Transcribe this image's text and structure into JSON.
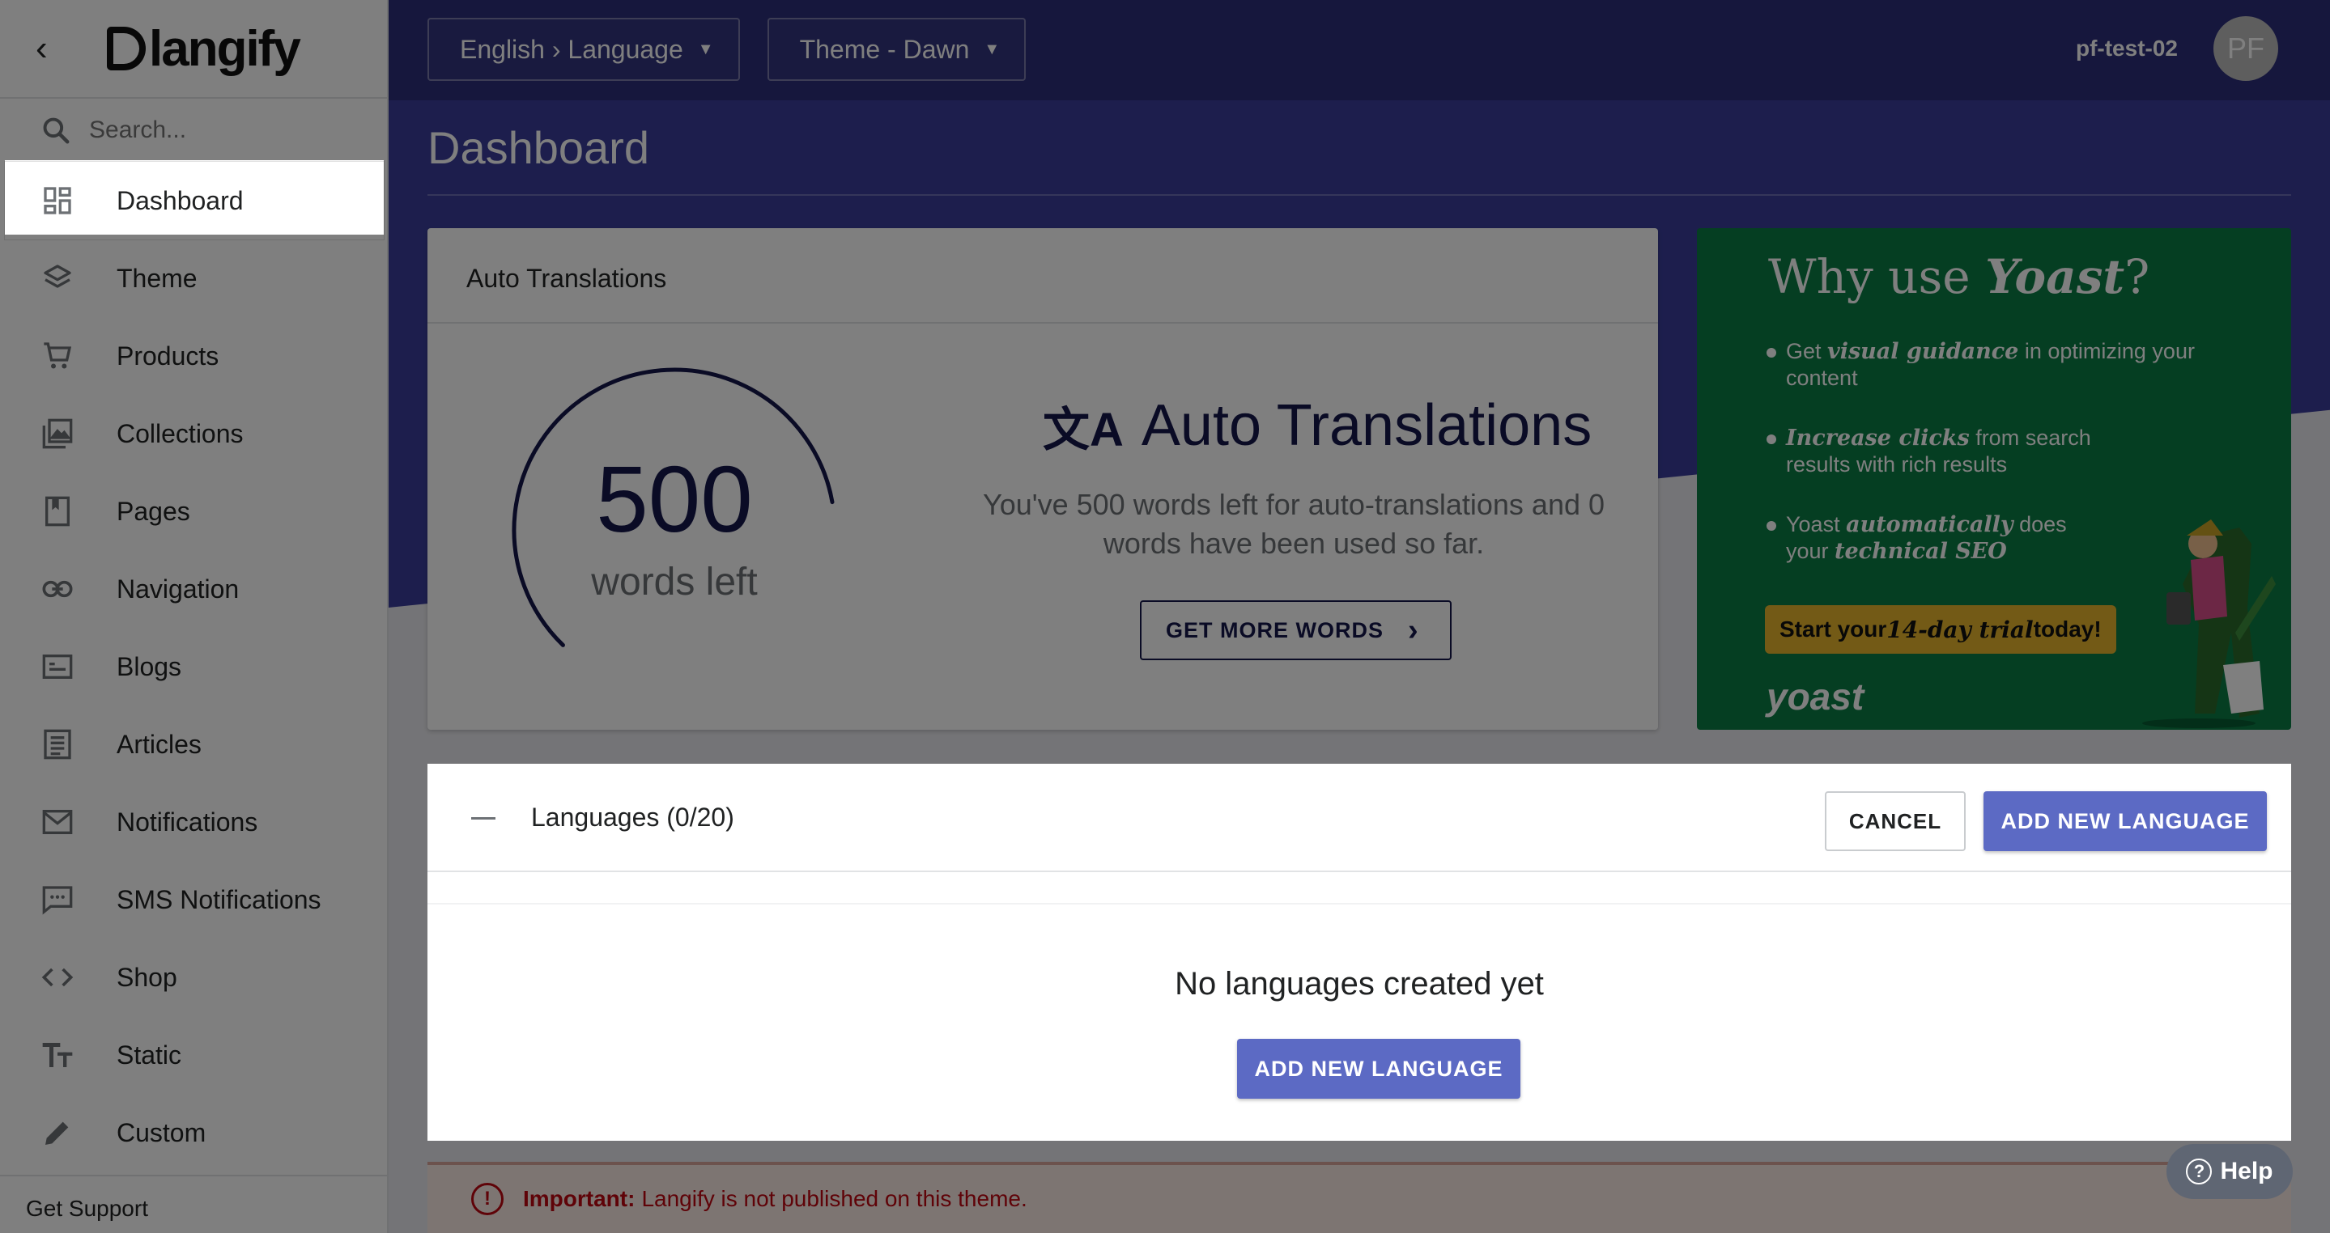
{
  "sidebar": {
    "logo_text": "langify",
    "search_placeholder": "Search...",
    "items": [
      {
        "label": "Dashboard"
      },
      {
        "label": "Theme"
      },
      {
        "label": "Products"
      },
      {
        "label": "Collections"
      },
      {
        "label": "Pages"
      },
      {
        "label": "Navigation"
      },
      {
        "label": "Blogs"
      },
      {
        "label": "Articles"
      },
      {
        "label": "Notifications"
      },
      {
        "label": "SMS Notifications"
      },
      {
        "label": "Shop"
      },
      {
        "label": "Static"
      },
      {
        "label": "Custom"
      }
    ],
    "support": "Get Support"
  },
  "header": {
    "language_dropdown": "English › Language",
    "theme_dropdown": "Theme - Dawn",
    "user_name": "pf-test-02",
    "avatar_initials": "PF"
  },
  "page_title": "Dashboard",
  "auto_card": {
    "header": "Auto Translations",
    "words_left_value": "500",
    "words_left_label": "words left",
    "remaining_fraction": 0.6,
    "title": "Auto Translations",
    "description": "You've 500 words left for auto-translations and 0 words have been used so far.",
    "button": "GET MORE WORDS"
  },
  "yoast": {
    "title_prefix": "Why use ",
    "title_brand": "Yoast",
    "title_suffix": "?",
    "b1_pre": "Get ",
    "b1_em": "visual guidance",
    "b1_post": " in optimizing your content",
    "b2_em": "Increase clicks",
    "b2_post": " from search results with rich results",
    "b3_pre": "Yoast ",
    "b3_em": "automatically",
    "b3_mid": " does your ",
    "b3_em2": "technical SEO",
    "cta_pre": "Start your ",
    "cta_em": "14-day trial",
    "cta_post": " today!",
    "logo": "yoast"
  },
  "languages": {
    "title": "Languages (0/20)",
    "cancel": "CANCEL",
    "add": "ADD NEW LANGUAGE",
    "empty": "No languages created yet",
    "add_center": "ADD NEW LANGUAGE"
  },
  "banner": {
    "label": "Important:",
    "text": "Langify is not published on this theme."
  },
  "help": "Help",
  "colors": {
    "header": "#2d2f7a",
    "accent": "#5c6ac4",
    "yoast_green": "#0b7d45",
    "warning": "#bf0711"
  }
}
